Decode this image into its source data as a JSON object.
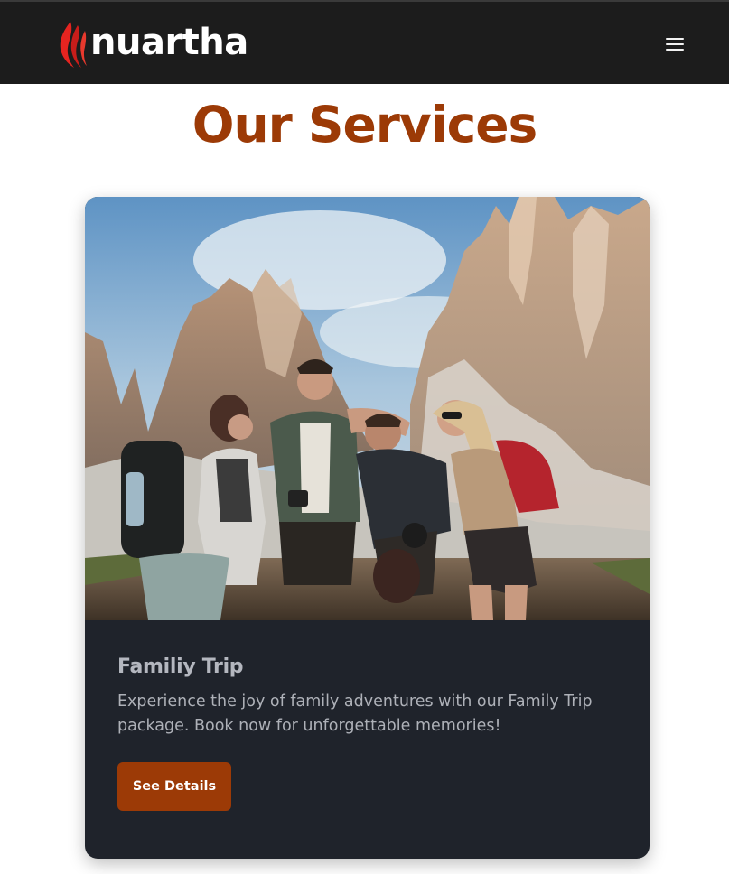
{
  "header": {
    "brand": "nuartha",
    "logo_icon": "flame-feather-logo-icon",
    "menu_icon": "hamburger-menu-icon"
  },
  "main": {
    "title": "Our Services"
  },
  "service_card": {
    "title": "Familiy Trip",
    "description": "Experience the joy of family adventures with our Family Trip package. Book now for unforgettable memories!",
    "button_label": "See Details",
    "image_description": "group-of-friends-hiking-mountains-photo"
  },
  "colors": {
    "header_bg": "#1c1c1c",
    "accent": "#9c3a06",
    "card_bg": "#1f232b",
    "card_text": "#aeb1b8",
    "logo_red": "#e52420"
  }
}
